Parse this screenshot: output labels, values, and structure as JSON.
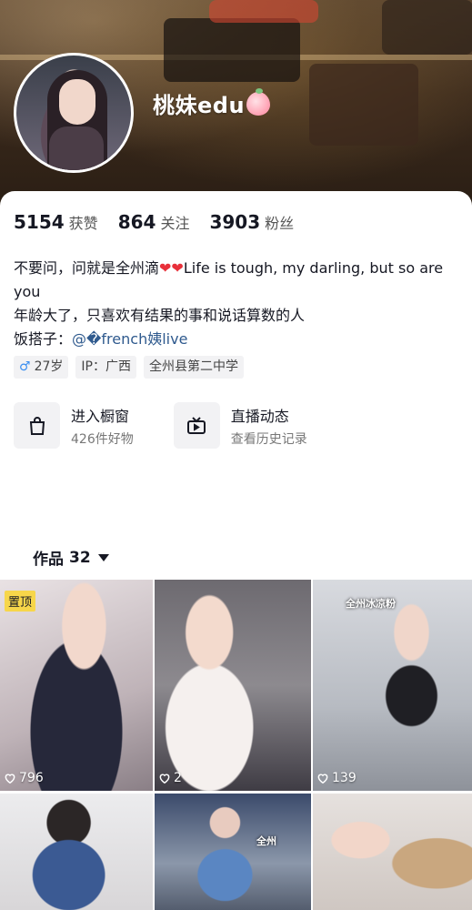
{
  "profile": {
    "username": "桃妹edu",
    "username_emoji": "peach-icon"
  },
  "stats": [
    {
      "value": "5154",
      "label": "获赞"
    },
    {
      "value": "864",
      "label": "关注"
    },
    {
      "value": "3903",
      "label": "粉丝"
    }
  ],
  "bio": {
    "line1_a": "不要问，问就是全州滴",
    "line1_b": "Life is tough, my darling, but so are you",
    "line2": "年龄大了，只喜欢有结果的事和说话算数的人",
    "line3_prefix": "饭搭子：",
    "line3_mention": "@�french姨live"
  },
  "tags": [
    {
      "label": "27岁",
      "icon": "male-icon"
    },
    {
      "label": "IP：广西"
    },
    {
      "label": "全州县第二中学"
    }
  ],
  "shortcuts": [
    {
      "title": "进入橱窗",
      "subtitle": "426件好物",
      "icon": "shopping-bag-icon"
    },
    {
      "title": "直播动态",
      "subtitle": "查看历史记录",
      "icon": "tv-icon"
    }
  ],
  "works": {
    "label": "作品",
    "count": "32"
  },
  "videos": [
    {
      "pinned_label": "置顶",
      "likes": "796"
    },
    {
      "likes": "2"
    },
    {
      "likes": "139",
      "overlay_text": "全州冰凉粉"
    },
    {
      "likes": ""
    },
    {
      "likes": "",
      "overlay_text": "全州"
    },
    {
      "likes": ""
    }
  ],
  "colors": {
    "accent_link": "#2f5a8e",
    "heart": "#e8303a",
    "pin_bg": "#f7d64a"
  }
}
